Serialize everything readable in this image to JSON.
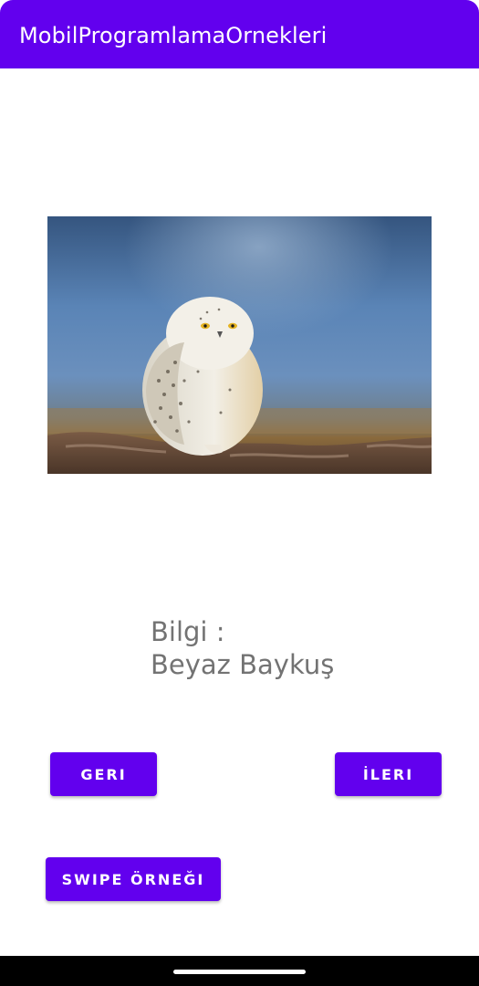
{
  "app_bar": {
    "title": "MobilProgramlamaOrnekleri",
    "color": "#6200ee"
  },
  "image": {
    "subject": "snowy-owl-photo"
  },
  "info": {
    "label": "Bilgi :",
    "value": "Beyaz Baykuş"
  },
  "buttons": {
    "back_label": "GERI",
    "next_label": "İLERI",
    "swipe_label": "SWIPE ÖRNEĞI"
  }
}
